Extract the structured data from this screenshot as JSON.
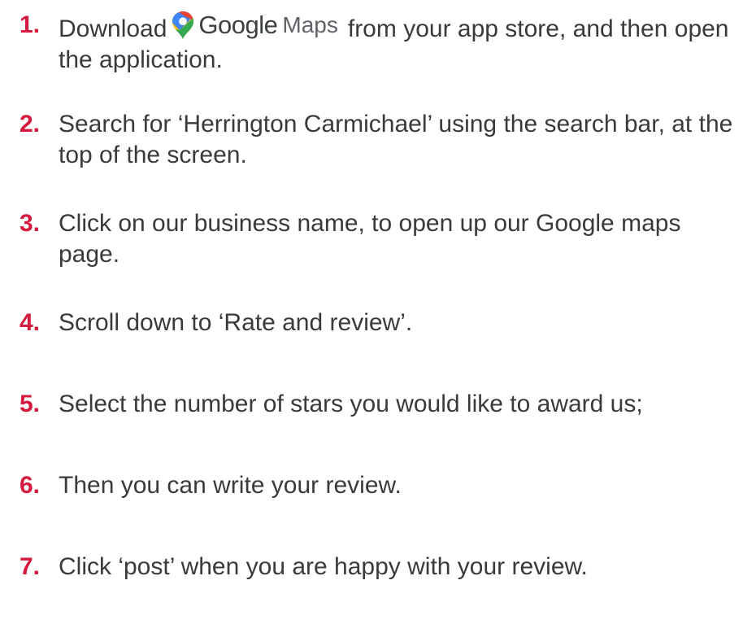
{
  "steps": [
    {
      "number": "1.",
      "text_before": "Download",
      "brand": {
        "icon": "google-maps-pin-icon",
        "word1": "Google",
        "word2": "Maps"
      },
      "text_after": "from your app store, and then open the application."
    },
    {
      "number": "2.",
      "text": "Search for ‘Herrington Carmichael’ using the search bar, at the top of the screen."
    },
    {
      "number": "3.",
      "text": "Click on our business name, to open up our Google maps page."
    },
    {
      "number": "4.",
      "text": "Scroll down to ‘Rate and review’."
    },
    {
      "number": "5.",
      "text": "Select the number of stars you would like to award us;"
    },
    {
      "number": "6.",
      "text": "Then you can write your review."
    },
    {
      "number": "7.",
      "text": "Click ‘post’ when you are happy with your review."
    }
  ],
  "colors": {
    "number": "#d5193f",
    "text": "#3a3a3a",
    "pin_red": "#ea4335",
    "pin_yellow": "#fbbc04",
    "pin_green": "#34a853",
    "pin_blue": "#4285f4"
  }
}
